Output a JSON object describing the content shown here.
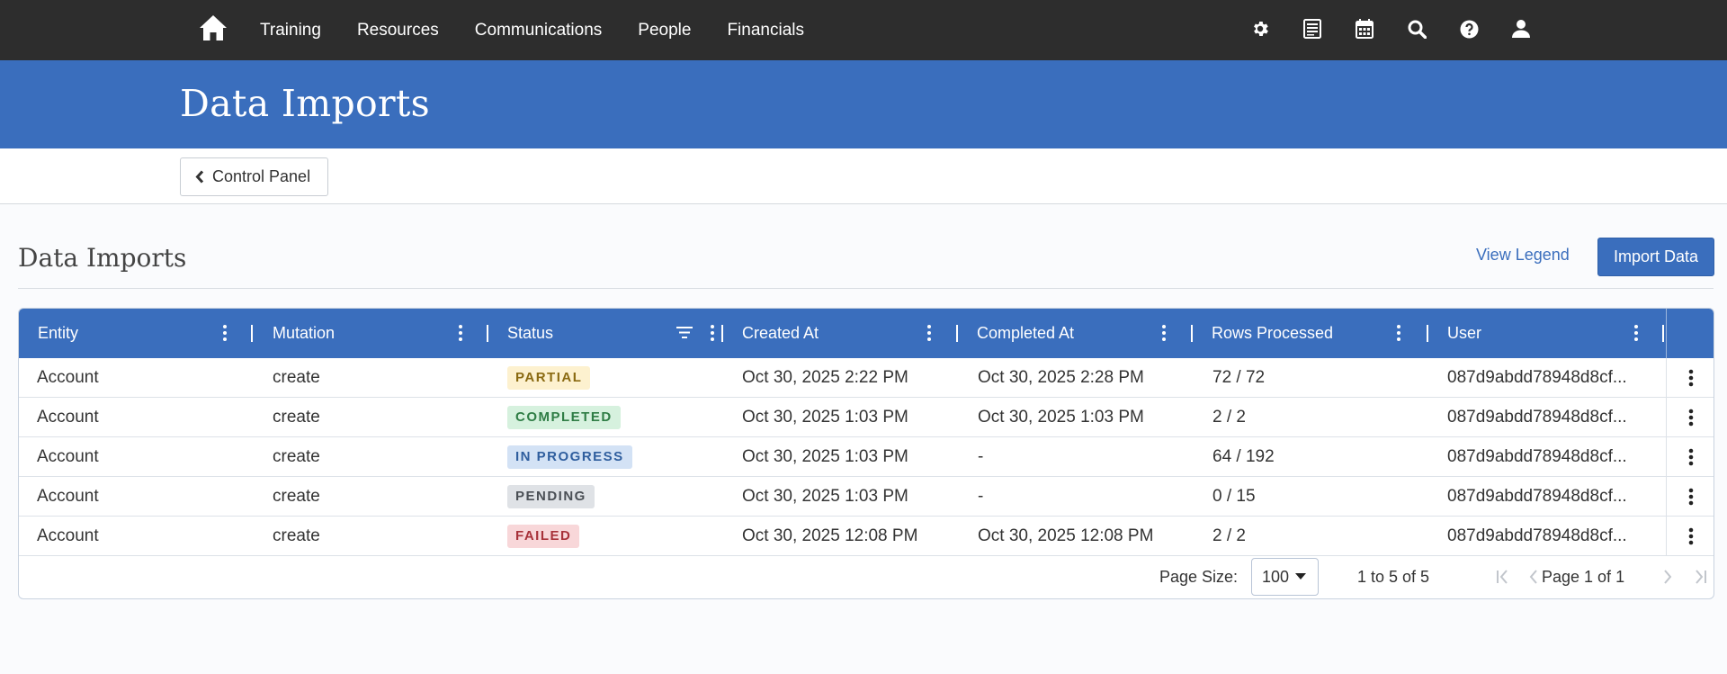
{
  "nav": {
    "links": [
      "Training",
      "Resources",
      "Communications",
      "People",
      "Financials"
    ],
    "icons": [
      "gear-icon",
      "list-icon",
      "calendar-icon",
      "search-icon",
      "help-icon",
      "user-icon"
    ]
  },
  "header": {
    "title": "Data Imports"
  },
  "breadcrumb": {
    "back_label": "Control Panel"
  },
  "section": {
    "title": "Data Imports",
    "view_legend_label": "View Legend",
    "import_label": "Import Data"
  },
  "table": {
    "columns": [
      "Entity",
      "Mutation",
      "Status",
      "Created At",
      "Completed At",
      "Rows Processed",
      "User"
    ],
    "rows": [
      {
        "entity": "Account",
        "mutation": "create",
        "status": "PARTIAL",
        "created": "Oct 30, 2025 2:22 PM",
        "completed": "Oct 30, 2025 2:28 PM",
        "rows": "72 / 72",
        "user": "087d9abdd78948d8cf..."
      },
      {
        "entity": "Account",
        "mutation": "create",
        "status": "COMPLETED",
        "created": "Oct 30, 2025 1:03 PM",
        "completed": "Oct 30, 2025 1:03 PM",
        "rows": "2 / 2",
        "user": "087d9abdd78948d8cf..."
      },
      {
        "entity": "Account",
        "mutation": "create",
        "status": "IN PROGRESS",
        "created": "Oct 30, 2025 1:03 PM",
        "completed": "-",
        "rows": "64 / 192",
        "user": "087d9abdd78948d8cf..."
      },
      {
        "entity": "Account",
        "mutation": "create",
        "status": "PENDING",
        "created": "Oct 30, 2025 1:03 PM",
        "completed": "-",
        "rows": "0 / 15",
        "user": "087d9abdd78948d8cf..."
      },
      {
        "entity": "Account",
        "mutation": "create",
        "status": "FAILED",
        "created": "Oct 30, 2025 12:08 PM",
        "completed": "Oct 30, 2025 12:08 PM",
        "rows": "2 / 2",
        "user": "087d9abdd78948d8cf..."
      }
    ],
    "status_colors": {
      "PARTIAL": {
        "bg": "#fdf1cf",
        "fg": "#8a6a12"
      },
      "COMPLETED": {
        "bg": "#d6f1de",
        "fg": "#2f7d45"
      },
      "IN PROGRESS": {
        "bg": "#d3e2f5",
        "fg": "#2f5e9e"
      },
      "PENDING": {
        "bg": "#dfe2e6",
        "fg": "#4a4f55"
      },
      "FAILED": {
        "bg": "#f8d7d9",
        "fg": "#a8323a"
      }
    }
  },
  "pagination": {
    "page_size_label": "Page Size:",
    "page_size": "100",
    "count_text": "1 to 5 of 5",
    "page_text": "Page 1 of 1"
  },
  "colors": {
    "nav_bg": "#2d2d2d",
    "brand_blue": "#3a6ebd"
  }
}
